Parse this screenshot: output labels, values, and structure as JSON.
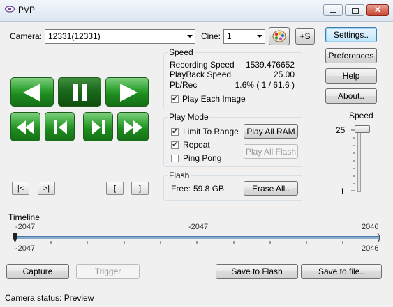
{
  "window": {
    "title": "PVP"
  },
  "camera": {
    "label": "Camera:",
    "value": "12331(12331)"
  },
  "cine": {
    "label": "Cine:",
    "value": "1"
  },
  "toolbar": {
    "plus_s": "+S"
  },
  "side_buttons": {
    "settings": "Settings..",
    "preferences": "Preferences",
    "help": "Help",
    "about": "About.."
  },
  "speed_group": {
    "title": "Speed",
    "recording_label": "Recording Speed",
    "recording_value": "1539.476652",
    "playback_label": "PlayBack Speed",
    "playback_value": "25.00",
    "pbrec_label": "Pb/Rec",
    "pbrec_value": "1.6% ( 1 / 61.6 )",
    "play_each_image": "Play Each Image"
  },
  "play_mode": {
    "title": "Play Mode",
    "limit_to_range": "Limit To Range",
    "repeat": "Repeat",
    "ping_pong": "Ping Pong",
    "play_all_ram": "Play All RAM",
    "play_all_flash": "Play All Flash"
  },
  "flash": {
    "title": "Flash",
    "free_label": "Free:",
    "free_value": "59.8 GB",
    "erase_all": "Erase All.."
  },
  "speed_slider": {
    "label": "Speed",
    "max_label": "25",
    "min_label": "1",
    "level": 25
  },
  "frame_nav": {
    "first": "|<",
    "last": ">|",
    "mark_in": "[",
    "mark_out": "]"
  },
  "timeline": {
    "label": "Timeline",
    "start_top": "-2047",
    "current": "-2047",
    "end_top": "2046",
    "start_bottom": "-2047",
    "end_bottom": "2046"
  },
  "bottom_buttons": {
    "capture": "Capture",
    "trigger": "Trigger",
    "save_flash": "Save to Flash",
    "save_file": "Save to file.."
  },
  "status": {
    "text": "Camera status: Preview"
  },
  "colors": {
    "green": "#2f9e2f",
    "accent": "#3c7fb1"
  }
}
